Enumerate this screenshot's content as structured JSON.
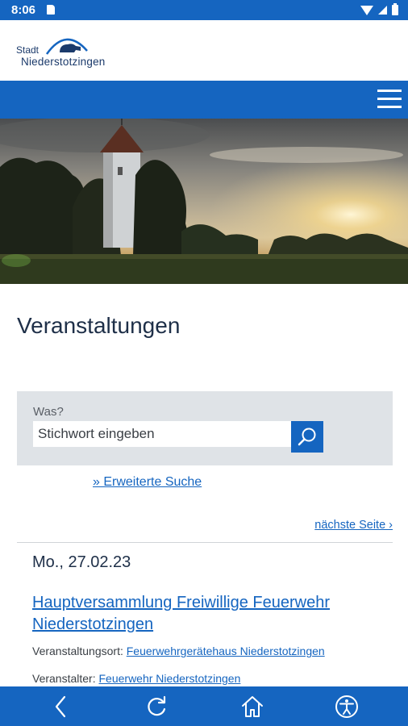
{
  "status_bar": {
    "time": "8:06"
  },
  "header": {
    "logo_line1": "Stadt",
    "logo_line2": "Niederstotzingen"
  },
  "main": {
    "title": "Veranstaltungen",
    "search": {
      "label": "Was?",
      "placeholder": "Stichwort eingeben"
    },
    "advanced_search_link": "» Erweiterte Suche",
    "next_page_link": "nächste Seite ›"
  },
  "event": {
    "date": "Mo., 27.02.23",
    "title": "Hauptversammlung Freiwillige Feuerwehr Niederstotzingen",
    "location_label": "Veranstaltungsort:",
    "location": "Feuerwehrgerätehaus Niederstotzingen",
    "organizer_label": "Veranstalter:",
    "organizer": "Feuerwehr Niederstotzingen"
  },
  "colors": {
    "primary": "#1565c0",
    "heading": "#1e2f48",
    "search_bg": "#dfe3e7"
  },
  "icons": {
    "menu": "hamburger-icon",
    "search": "search-icon",
    "back": "back-icon",
    "reload": "reload-icon",
    "home": "home-icon",
    "accessibility": "accessibility-icon"
  }
}
